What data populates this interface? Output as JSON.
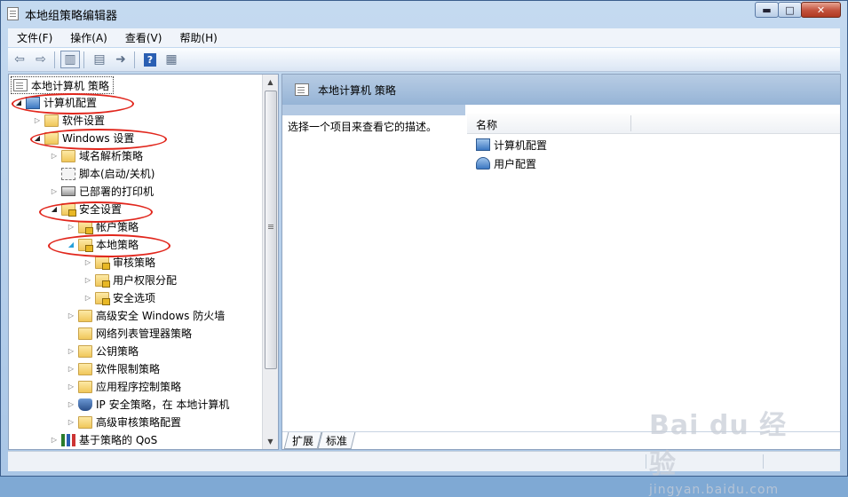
{
  "window": {
    "title": "本地组策略编辑器",
    "caption_buttons": {
      "minimize": "▬",
      "maximize": "□",
      "close": "✕"
    }
  },
  "menubar": {
    "items": [
      "文件(F)",
      "操作(A)",
      "查看(V)",
      "帮助(H)"
    ]
  },
  "toolbar": {
    "buttons": [
      "back-icon",
      "forward-icon",
      "show-hide-tree-icon",
      "properties-icon",
      "export-list-icon",
      "help-icon",
      "action-pane-icon"
    ],
    "help_glyph": "?"
  },
  "tree": {
    "root": "本地计算机 策略",
    "items": [
      {
        "label": "计算机配置",
        "icon": "computer-icon",
        "state": "expanded"
      },
      {
        "label": "软件设置",
        "icon": "folder-icon",
        "state": "collapsed"
      },
      {
        "label": "Windows 设置",
        "icon": "folder-icon",
        "state": "expanded"
      },
      {
        "label": "域名解析策略",
        "icon": "folder-icon",
        "state": "collapsed"
      },
      {
        "label": "脚本(启动/关机)",
        "icon": "script-icon",
        "state": "none"
      },
      {
        "label": "已部署的打印机",
        "icon": "printer-icon",
        "state": "collapsed"
      },
      {
        "label": "安全设置",
        "icon": "security-icon",
        "state": "expanded"
      },
      {
        "label": "帐户策略",
        "icon": "lock-folder-icon",
        "state": "collapsed"
      },
      {
        "label": "本地策略",
        "icon": "lock-folder-icon",
        "state": "expanded-selected"
      },
      {
        "label": "审核策略",
        "icon": "lock-folder-icon",
        "state": "collapsed"
      },
      {
        "label": "用户权限分配",
        "icon": "lock-folder-icon",
        "state": "collapsed"
      },
      {
        "label": "安全选项",
        "icon": "lock-folder-icon",
        "state": "collapsed"
      },
      {
        "label": "高级安全 Windows 防火墙",
        "icon": "folder-icon",
        "state": "collapsed"
      },
      {
        "label": "网络列表管理器策略",
        "icon": "folder-icon",
        "state": "none"
      },
      {
        "label": "公钥策略",
        "icon": "folder-icon",
        "state": "collapsed"
      },
      {
        "label": "软件限制策略",
        "icon": "folder-icon",
        "state": "collapsed"
      },
      {
        "label": "应用程序控制策略",
        "icon": "folder-icon",
        "state": "collapsed"
      },
      {
        "label": "IP 安全策略，在 本地计算机",
        "icon": "ip-security-icon",
        "state": "collapsed"
      },
      {
        "label": "高级审核策略配置",
        "icon": "folder-icon",
        "state": "collapsed"
      },
      {
        "label": "基于策略的 QoS",
        "icon": "qos-chart-icon",
        "state": "collapsed"
      }
    ]
  },
  "details": {
    "header_title": "本地计算机 策略",
    "description": "选择一个项目来查看它的描述。",
    "column_name": "名称",
    "items": [
      "计算机配置",
      "用户配置"
    ],
    "tabs": [
      "扩展",
      "标准"
    ]
  },
  "watermark": {
    "brand": "Bai du 经验",
    "url": "jingyan.baidu.com"
  },
  "colors": {
    "annotation_ellipse": "#e1261c",
    "header_band": "#9cb9da"
  }
}
